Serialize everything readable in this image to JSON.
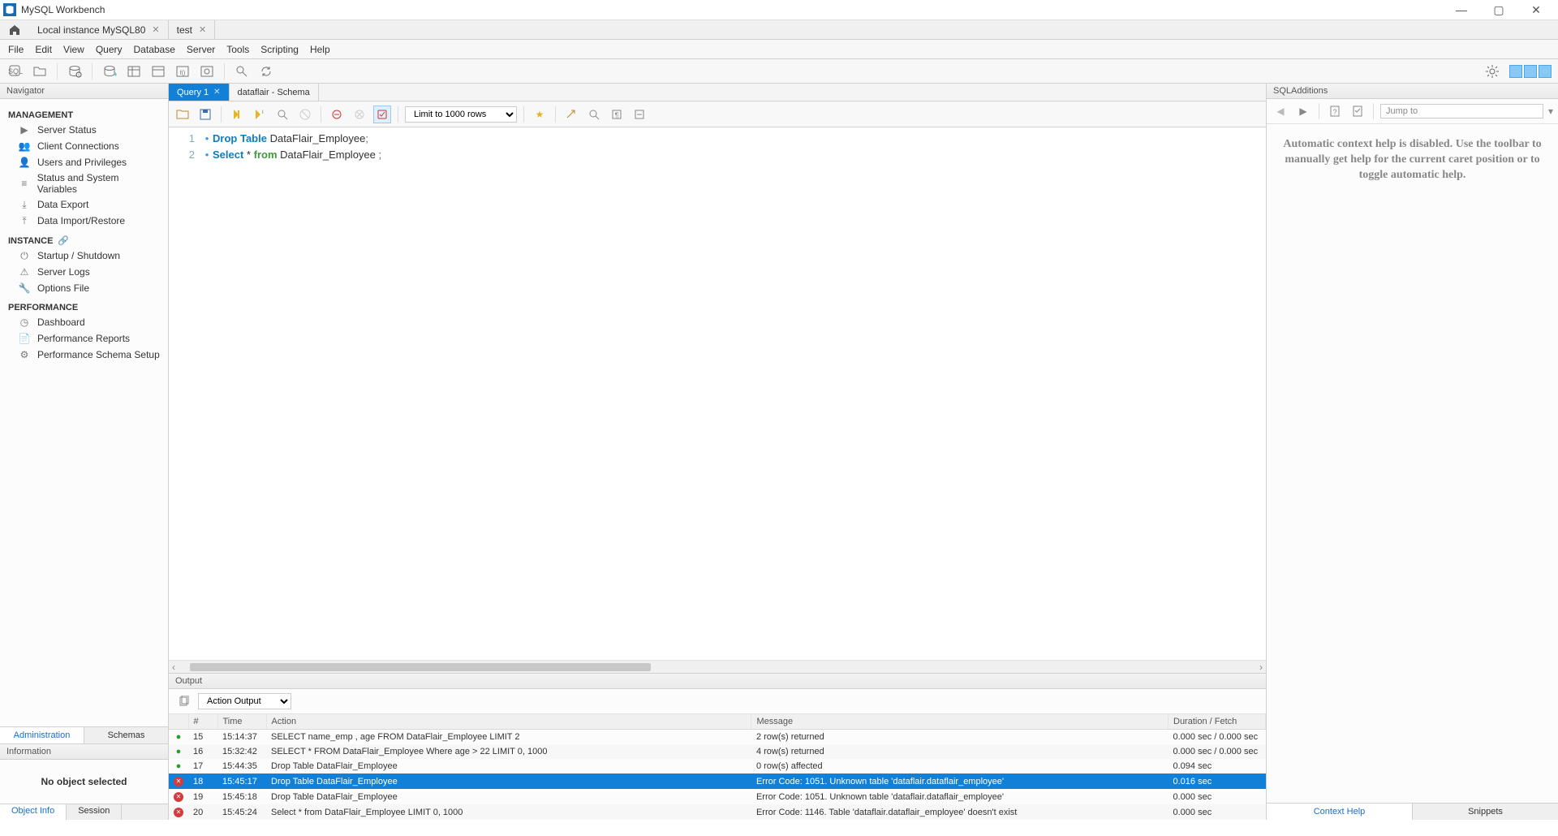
{
  "window": {
    "title": "MySQL Workbench"
  },
  "top_tabs": [
    {
      "label": "Local instance MySQL80"
    },
    {
      "label": "test"
    }
  ],
  "menu": [
    "File",
    "Edit",
    "View",
    "Query",
    "Database",
    "Server",
    "Tools",
    "Scripting",
    "Help"
  ],
  "navigator": {
    "title": "Navigator",
    "sections": {
      "management": {
        "label": "MANAGEMENT",
        "items": [
          "Server Status",
          "Client Connections",
          "Users and Privileges",
          "Status and System Variables",
          "Data Export",
          "Data Import/Restore"
        ]
      },
      "instance": {
        "label": "INSTANCE",
        "items": [
          "Startup / Shutdown",
          "Server Logs",
          "Options File"
        ]
      },
      "performance": {
        "label": "PERFORMANCE",
        "items": [
          "Dashboard",
          "Performance Reports",
          "Performance Schema Setup"
        ]
      }
    },
    "tabs": [
      "Administration",
      "Schemas"
    ]
  },
  "information": {
    "title": "Information",
    "body": "No object selected"
  },
  "footer_tabs": [
    "Object Info",
    "Session"
  ],
  "editor": {
    "tabs": [
      {
        "label": "Query 1",
        "active": true
      },
      {
        "label": "dataflair - Schema",
        "active": false
      }
    ],
    "limit_label": "Limit to 1000 rows",
    "code": [
      {
        "n": 1,
        "tokens": [
          {
            "t": "Drop",
            "c": "kw-blue"
          },
          {
            "t": " ",
            "c": "txt"
          },
          {
            "t": "Table",
            "c": "kw-blue"
          },
          {
            "t": " DataFlair_Employee",
            "c": "txt"
          },
          {
            "t": ";",
            "c": "punct"
          }
        ]
      },
      {
        "n": 2,
        "tokens": [
          {
            "t": "Select",
            "c": "kw-blue"
          },
          {
            "t": " * ",
            "c": "txt"
          },
          {
            "t": "from",
            "c": "kw-green"
          },
          {
            "t": " DataFlair_Employee ",
            "c": "txt"
          },
          {
            "t": ";",
            "c": "punct"
          }
        ]
      }
    ]
  },
  "output": {
    "title": "Output",
    "selector": "Action Output",
    "columns": [
      "",
      "#",
      "Time",
      "Action",
      "Message",
      "Duration / Fetch"
    ],
    "rows": [
      {
        "status": "ok",
        "n": 15,
        "time": "15:14:37",
        "action": "SELECT name_emp , age FROM DataFlair_Employee LIMIT 2",
        "message": "2 row(s) returned",
        "duration": "0.000 sec / 0.000 sec",
        "selected": false,
        "alt": false
      },
      {
        "status": "ok",
        "n": 16,
        "time": "15:32:42",
        "action": "SELECT * FROM DataFlair_Employee Where age > 22 LIMIT 0, 1000",
        "message": "4 row(s) returned",
        "duration": "0.000 sec / 0.000 sec",
        "selected": false,
        "alt": true
      },
      {
        "status": "ok",
        "n": 17,
        "time": "15:44:35",
        "action": "Drop Table DataFlair_Employee",
        "message": "0 row(s) affected",
        "duration": "0.094 sec",
        "selected": false,
        "alt": false
      },
      {
        "status": "err",
        "n": 18,
        "time": "15:45:17",
        "action": "Drop Table DataFlair_Employee",
        "message": "Error Code: 1051. Unknown table 'dataflair.dataflair_employee'",
        "duration": "0.016 sec",
        "selected": true,
        "alt": true
      },
      {
        "status": "err",
        "n": 19,
        "time": "15:45:18",
        "action": "Drop Table DataFlair_Employee",
        "message": "Error Code: 1051. Unknown table 'dataflair.dataflair_employee'",
        "duration": "0.000 sec",
        "selected": false,
        "alt": false
      },
      {
        "status": "err",
        "n": 20,
        "time": "15:45:24",
        "action": "Select * from DataFlair_Employee LIMIT 0, 1000",
        "message": "Error Code: 1146. Table 'dataflair.dataflair_employee' doesn't exist",
        "duration": "0.000 sec",
        "selected": false,
        "alt": true
      }
    ]
  },
  "sqladditions": {
    "title": "SQLAdditions",
    "jumpto": "Jump to",
    "body": "Automatic context help is disabled. Use the toolbar to manually get help for the current caret position or to toggle automatic help.",
    "tabs": [
      "Context Help",
      "Snippets"
    ]
  }
}
